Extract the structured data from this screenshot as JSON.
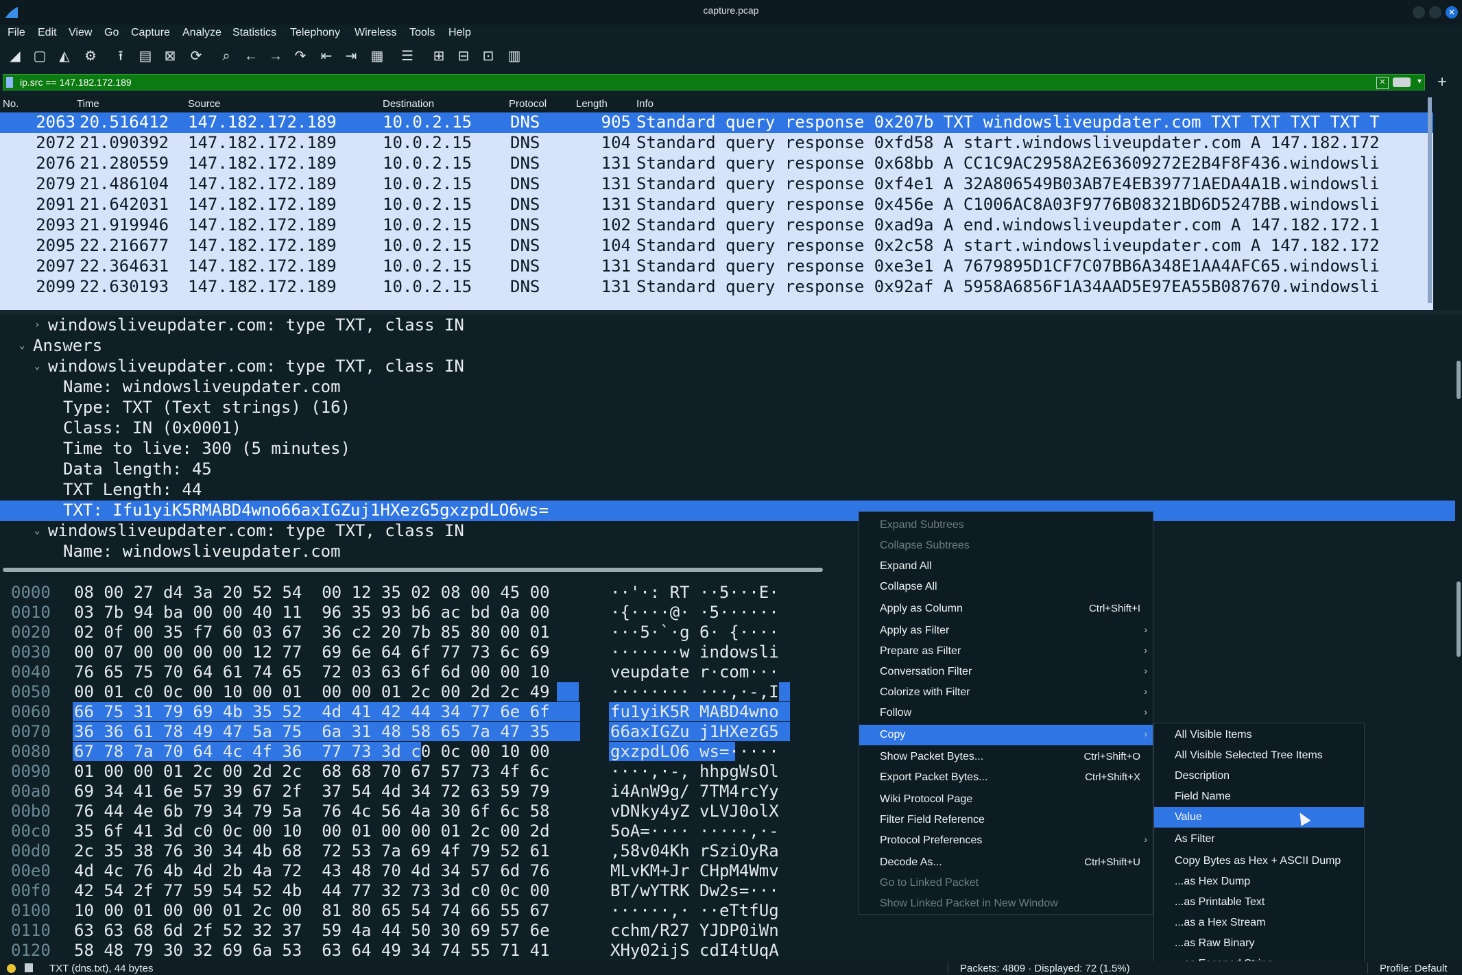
{
  "window": {
    "title": "capture.pcap"
  },
  "menu": [
    "File",
    "Edit",
    "View",
    "Go",
    "Capture",
    "Analyze",
    "Statistics",
    "Telephony",
    "Wireless",
    "Tools",
    "Help"
  ],
  "filter": {
    "text": "ip.src == 147.182.172.189"
  },
  "columns": [
    "No.",
    "Time",
    "Source",
    "Destination",
    "Protocol",
    "Length",
    "Info"
  ],
  "packets": [
    {
      "no": "2063",
      "time": "20.516412",
      "src": "147.182.172.189",
      "dst": "10.0.2.15",
      "proto": "DNS",
      "len": "905",
      "info": "Standard query response 0x207b TXT windowsliveupdater.com TXT TXT TXT TXT T",
      "selected": true
    },
    {
      "no": "2072",
      "time": "21.090392",
      "src": "147.182.172.189",
      "dst": "10.0.2.15",
      "proto": "DNS",
      "len": "104",
      "info": "Standard query response 0xfd58 A start.windowsliveupdater.com A 147.182.172"
    },
    {
      "no": "2076",
      "time": "21.280559",
      "src": "147.182.172.189",
      "dst": "10.0.2.15",
      "proto": "DNS",
      "len": "131",
      "info": "Standard query response 0x68bb A CC1C9AC2958A2E63609272E2B4F8F436.windowsli"
    },
    {
      "no": "2079",
      "time": "21.486104",
      "src": "147.182.172.189",
      "dst": "10.0.2.15",
      "proto": "DNS",
      "len": "131",
      "info": "Standard query response 0xf4e1 A 32A806549B03AB7E4EB39771AEDA4A1B.windowsli"
    },
    {
      "no": "2091",
      "time": "21.642031",
      "src": "147.182.172.189",
      "dst": "10.0.2.15",
      "proto": "DNS",
      "len": "131",
      "info": "Standard query response 0x456e A C1006AC8A03F9776B08321BD6D5247BB.windowsli"
    },
    {
      "no": "2093",
      "time": "21.919946",
      "src": "147.182.172.189",
      "dst": "10.0.2.15",
      "proto": "DNS",
      "len": "102",
      "info": "Standard query response 0xad9a A end.windowsliveupdater.com A 147.182.172.1"
    },
    {
      "no": "2095",
      "time": "22.216677",
      "src": "147.182.172.189",
      "dst": "10.0.2.15",
      "proto": "DNS",
      "len": "104",
      "info": "Standard query response 0x2c58 A start.windowsliveupdater.com A 147.182.172"
    },
    {
      "no": "2097",
      "time": "22.364631",
      "src": "147.182.172.189",
      "dst": "10.0.2.15",
      "proto": "DNS",
      "len": "131",
      "info": "Standard query response 0xe3e1 A 7679895D1CF7C07BB6A348E1AA4AFC65.windowsli"
    },
    {
      "no": "2099",
      "time": "22.630193",
      "src": "147.182.172.189",
      "dst": "10.0.2.15",
      "proto": "DNS",
      "len": "131",
      "info": "Standard query response 0x92af A 5958A6856F1A34AAD5E97EA55B087670.windowsli"
    }
  ],
  "details": [
    {
      "text": "windowsliveupdater.com: type TXT, class IN",
      "arrow": "collapsed",
      "indent": 1
    },
    {
      "text": "Answers",
      "arrow": "expanded",
      "indent": 0
    },
    {
      "text": "windowsliveupdater.com: type TXT, class IN",
      "arrow": "expanded",
      "indent": 1
    },
    {
      "text": "Name: windowsliveupdater.com",
      "indent": 2
    },
    {
      "text": "Type: TXT (Text strings) (16)",
      "indent": 2
    },
    {
      "text": "Class: IN (0x0001)",
      "indent": 2
    },
    {
      "text": "Time to live: 300 (5 minutes)",
      "indent": 2
    },
    {
      "text": "Data length: 45",
      "indent": 2
    },
    {
      "text": "TXT Length: 44",
      "indent": 2
    },
    {
      "text": "TXT: Ifu1yiK5RMABD4wno66axIGZuj1HXezG5gxzpdLO6ws=",
      "indent": 2,
      "selected": true
    },
    {
      "text": "windowsliveupdater.com: type TXT, class IN",
      "arrow": "expanded",
      "indent": 1
    },
    {
      "text": "Name: windowsliveupdater.com",
      "indent": 2
    }
  ],
  "bytes": [
    {
      "off": "0000",
      "hex": "08 00 27 d4 3a 20 52 54  00 12 35 02 08 00 45 00",
      "ascii": "··'·: RT ··5···E·"
    },
    {
      "off": "0010",
      "hex": "03 7b 94 ba 00 00 40 11  96 35 93 b6 ac bd 0a 00",
      "ascii": "·{····@· ·5······"
    },
    {
      "off": "0020",
      "hex": "02 0f 00 35 f7 60 03 67  36 c2 20 7b 85 80 00 01",
      "ascii": "···5·`·g 6· {····"
    },
    {
      "off": "0030",
      "hex": "00 07 00 00 00 00 12 77  69 6e 64 6f 77 73 6c 69",
      "ascii": "·······w indowsli"
    },
    {
      "off": "0040",
      "hex": "76 65 75 70 64 61 74 65  72 03 63 6f 6d 00 00 10",
      "ascii": "veupdate r·com···"
    },
    {
      "off": "0050",
      "hex": "00 01 c0 0c 00 10 00 01  00 00 01 2c 00 2d 2c 49",
      "ascii": "········ ···,·-,I"
    },
    {
      "off": "0060",
      "hex": "66 75 31 79 69 4b 35 52  4d 41 42 44 34 77 6e 6f",
      "ascii": "fu1yiK5R MABD4wno"
    },
    {
      "off": "0070",
      "hex": "36 36 61 78 49 47 5a 75  6a 31 48 58 65 7a 47 35",
      "ascii": "66axIGZu j1HXezG5"
    },
    {
      "off": "0080",
      "hex": "67 78 7a 70 64 4c 4f 36  77 73 3d c0 0c 00 10 00",
      "ascii": "gxzpdLO6 ws=·····"
    },
    {
      "off": "0090",
      "hex": "01 00 00 01 2c 00 2d 2c  68 68 70 67 57 73 4f 6c",
      "ascii": "····,·-, hhpgWsOl"
    },
    {
      "off": "00a0",
      "hex": "69 34 41 6e 57 39 67 2f  37 54 4d 34 72 63 59 79",
      "ascii": "i4AnW9g/ 7TM4rcYy"
    },
    {
      "off": "00b0",
      "hex": "76 44 4e 6b 79 34 79 5a  76 4c 56 4a 30 6f 6c 58",
      "ascii": "vDNky4yZ vLVJ0olX"
    },
    {
      "off": "00c0",
      "hex": "35 6f 41 3d c0 0c 00 10  00 01 00 00 01 2c 00 2d",
      "ascii": "5oA=···· ·····,·-"
    },
    {
      "off": "00d0",
      "hex": "2c 35 38 76 30 34 4b 68  72 53 7a 69 4f 79 52 61",
      "ascii": ",58v04Kh rSziOyRa"
    },
    {
      "off": "00e0",
      "hex": "4d 4c 76 4b 4d 2b 4a 72  43 48 70 4d 34 57 6d 76",
      "ascii": "MLvKM+Jr CHpM4Wmv"
    },
    {
      "off": "00f0",
      "hex": "42 54 2f 77 59 54 52 4b  44 77 32 73 3d c0 0c 00",
      "ascii": "BT/wYTRK Dw2s=···"
    },
    {
      "off": "0100",
      "hex": "10 00 01 00 00 01 2c 00  81 80 65 54 74 66 55 67",
      "ascii": "······,· ··eTtfUg"
    },
    {
      "off": "0110",
      "hex": "63 63 68 6d 2f 52 32 37  59 4a 44 50 30 69 57 6e",
      "ascii": "cchm/R27 YJDP0iWn"
    },
    {
      "off": "0120",
      "hex": "58 48 79 30 32 69 6a 53  63 64 49 34 74 55 71 41",
      "ascii": "XHy02ijS cdI4tUqA"
    }
  ],
  "context_menu": [
    {
      "label": "Expand Subtrees",
      "disabled": true
    },
    {
      "label": "Collapse Subtrees",
      "disabled": true
    },
    {
      "label": "Expand All"
    },
    {
      "label": "Collapse All"
    },
    {
      "label": "Apply as Column",
      "shortcut": "Ctrl+Shift+I"
    },
    {
      "label": "Apply as Filter",
      "submenu": true
    },
    {
      "label": "Prepare as Filter",
      "submenu": true
    },
    {
      "label": "Conversation Filter",
      "submenu": true
    },
    {
      "label": "Colorize with Filter",
      "submenu": true
    },
    {
      "label": "Follow",
      "submenu": true
    },
    {
      "label": "Copy",
      "submenu": true,
      "active": true
    },
    {
      "label": "Show Packet Bytes...",
      "shortcut": "Ctrl+Shift+O"
    },
    {
      "label": "Export Packet Bytes...",
      "shortcut": "Ctrl+Shift+X"
    },
    {
      "label": "Wiki Protocol Page"
    },
    {
      "label": "Filter Field Reference"
    },
    {
      "label": "Protocol Preferences",
      "submenu": true
    },
    {
      "label": "Decode As...",
      "shortcut": "Ctrl+Shift+U"
    },
    {
      "label": "Go to Linked Packet",
      "disabled": true
    },
    {
      "label": "Show Linked Packet in New Window",
      "disabled": true
    }
  ],
  "copy_submenu": [
    {
      "label": "All Visible Items"
    },
    {
      "label": "All Visible Selected Tree Items"
    },
    {
      "label": "Description"
    },
    {
      "label": "Field Name"
    },
    {
      "label": "Value",
      "active": true
    },
    {
      "label": "As Filter"
    },
    {
      "label": "Copy Bytes as Hex + ASCII Dump"
    },
    {
      "label": "...as Hex Dump"
    },
    {
      "label": "...as Printable Text"
    },
    {
      "label": "...as a Hex Stream"
    },
    {
      "label": "...as Raw Binary"
    },
    {
      "label": "...as Escaped String"
    }
  ],
  "status": {
    "field": "TXT (dns.txt), 44 bytes",
    "packets": "Packets: 4809 · Displayed: 72 (1.5%)",
    "profile": "Profile: Default"
  },
  "colors": {
    "selection": "#2f75e3",
    "filter_valid": "#0b7a10",
    "packet_row": "#d6e3fa"
  }
}
